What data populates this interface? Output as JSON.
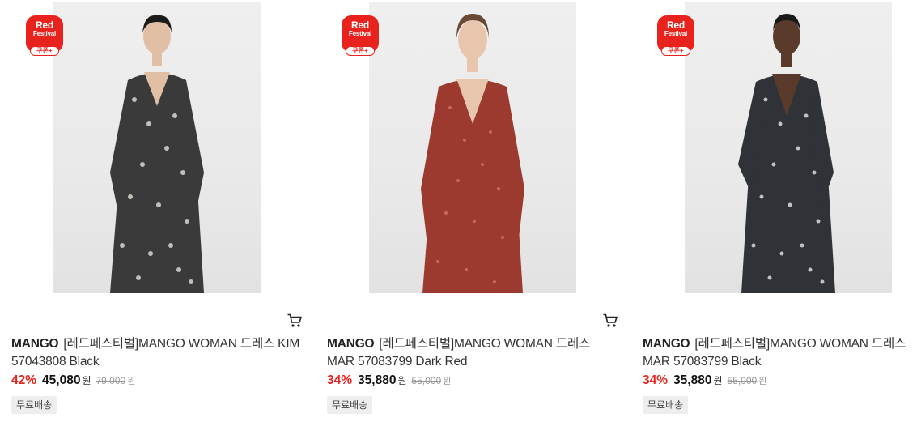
{
  "badge": {
    "line1": "Red",
    "line2": "Festival",
    "coupon": "쿠폰+"
  },
  "products": [
    {
      "image_alt": "model wearing black and white leopard print long dress",
      "brand": "MANGO",
      "name": "[레드페스티벌]MANGO WOMAN 드레스 KIM 57043808 Black",
      "discount": "42%",
      "sale_price": "45,080",
      "currency": "원",
      "original_price": "79,000",
      "original_currency": "원",
      "shipping": "무료배송",
      "dress_color": "#3a3a3a",
      "pattern_color": "#d9d6cf",
      "show_cart": true
    },
    {
      "image_alt": "model wearing dark red print v-neck long dress",
      "brand": "MANGO",
      "name": "[레드페스티벌]MANGO WOMAN 드레스 MAR 57083799 Dark Red",
      "discount": "34%",
      "sale_price": "35,880",
      "currency": "원",
      "original_price": "55,000",
      "original_currency": "원",
      "shipping": "무료배송",
      "dress_color": "#9c3a2f",
      "pattern_color": "#c9705f",
      "show_cart": true
    },
    {
      "image_alt": "model wearing black and white floral print long dress",
      "brand": "MANGO",
      "name": "[레드페스티벌]MANGO WOMAN 드레스 MAR 57083799 Black",
      "discount": "34%",
      "sale_price": "35,880",
      "currency": "원",
      "original_price": "55,000",
      "original_currency": "원",
      "shipping": "무료배송",
      "dress_color": "#2f3236",
      "pattern_color": "#cfd2d6",
      "show_cart": false
    }
  ],
  "icons": {
    "cart": "cart-icon"
  },
  "colors": {
    "accent": "#e8231d",
    "badge_bg": "#e8231d",
    "ship_bg": "#eeeeee"
  }
}
